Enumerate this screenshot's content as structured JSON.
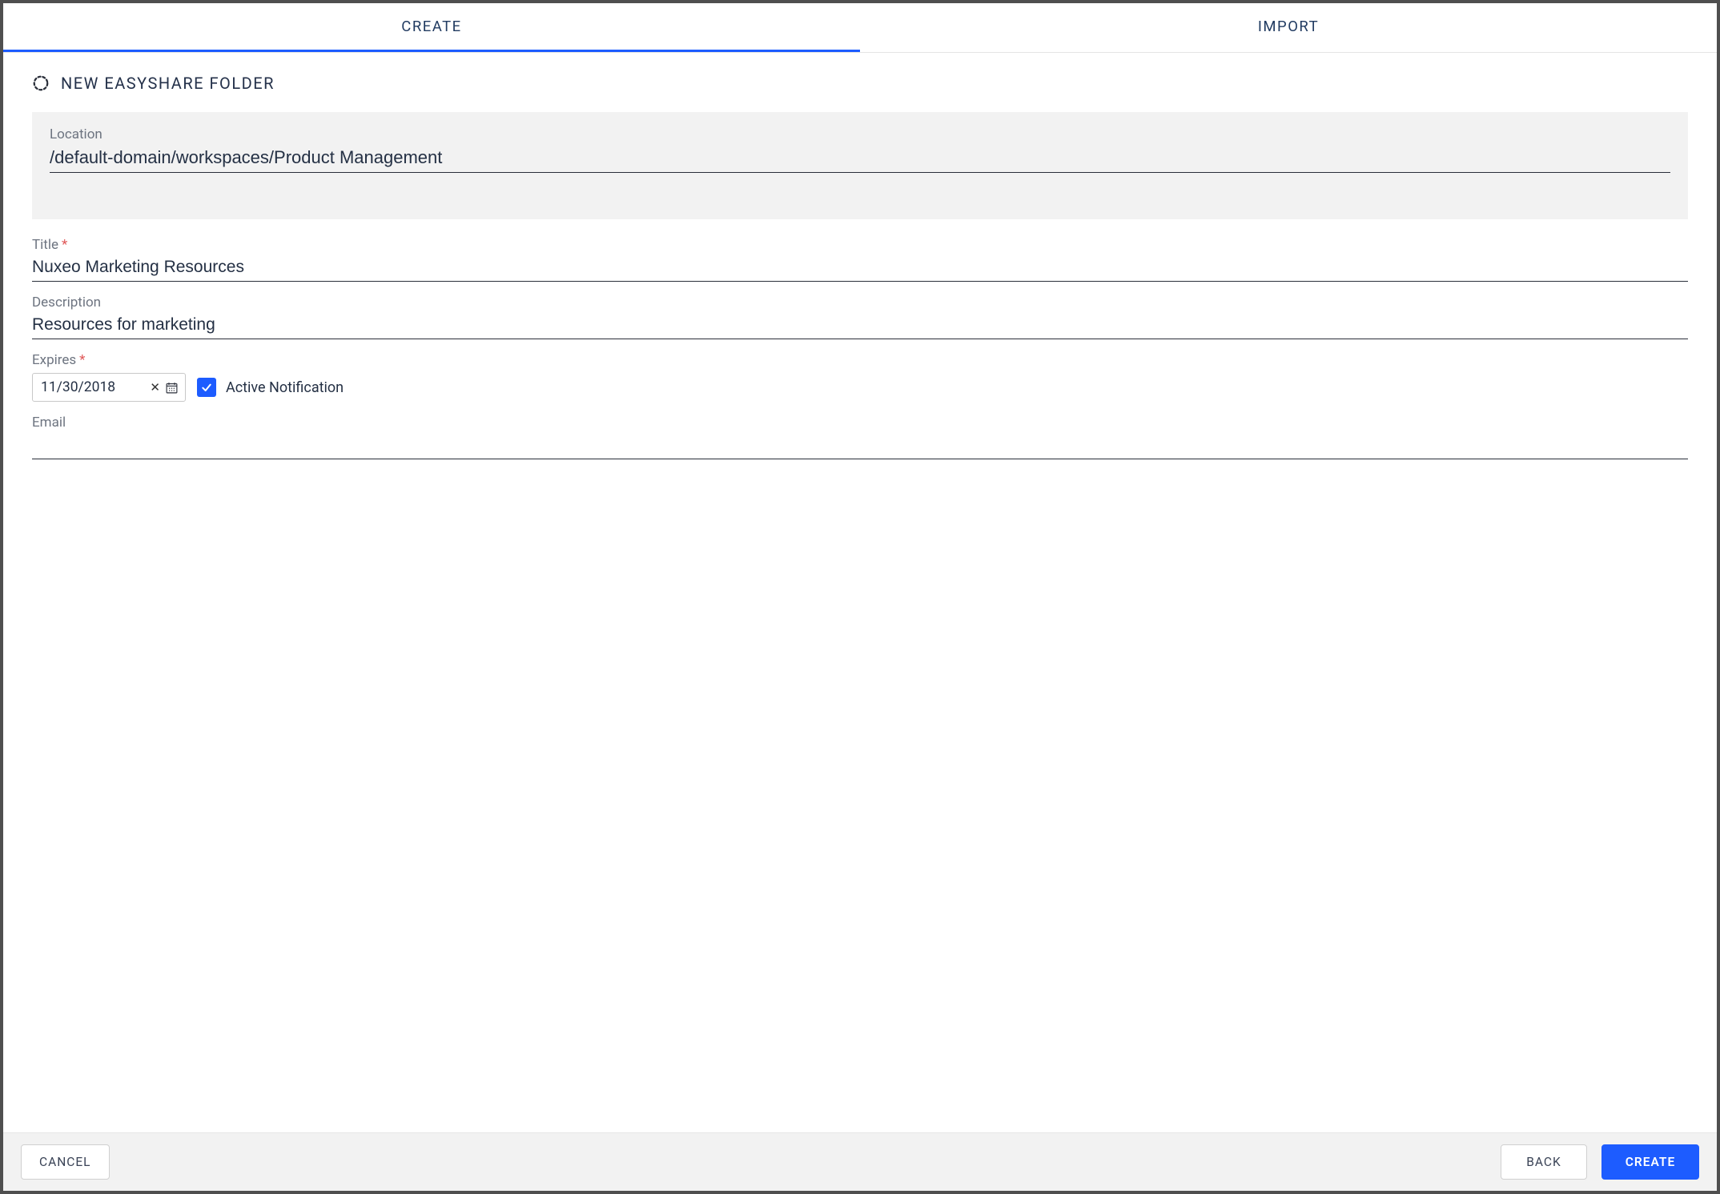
{
  "tabs": {
    "create": "CREATE",
    "import": "IMPORT",
    "active": "create"
  },
  "header": {
    "title": "NEW EASYSHARE FOLDER"
  },
  "form": {
    "location_label": "Location",
    "location_value": "/default-domain/workspaces/Product Management",
    "title_label": "Title",
    "title_value": "Nuxeo Marketing Resources",
    "description_label": "Description",
    "description_value": "Resources for marketing",
    "expires_label": "Expires",
    "expires_value": "11/30/2018",
    "active_notification_label": "Active Notification",
    "active_notification_checked": true,
    "email_label": "Email",
    "email_value": ""
  },
  "footer": {
    "cancel": "CANCEL",
    "back": "BACK",
    "create": "CREATE"
  }
}
